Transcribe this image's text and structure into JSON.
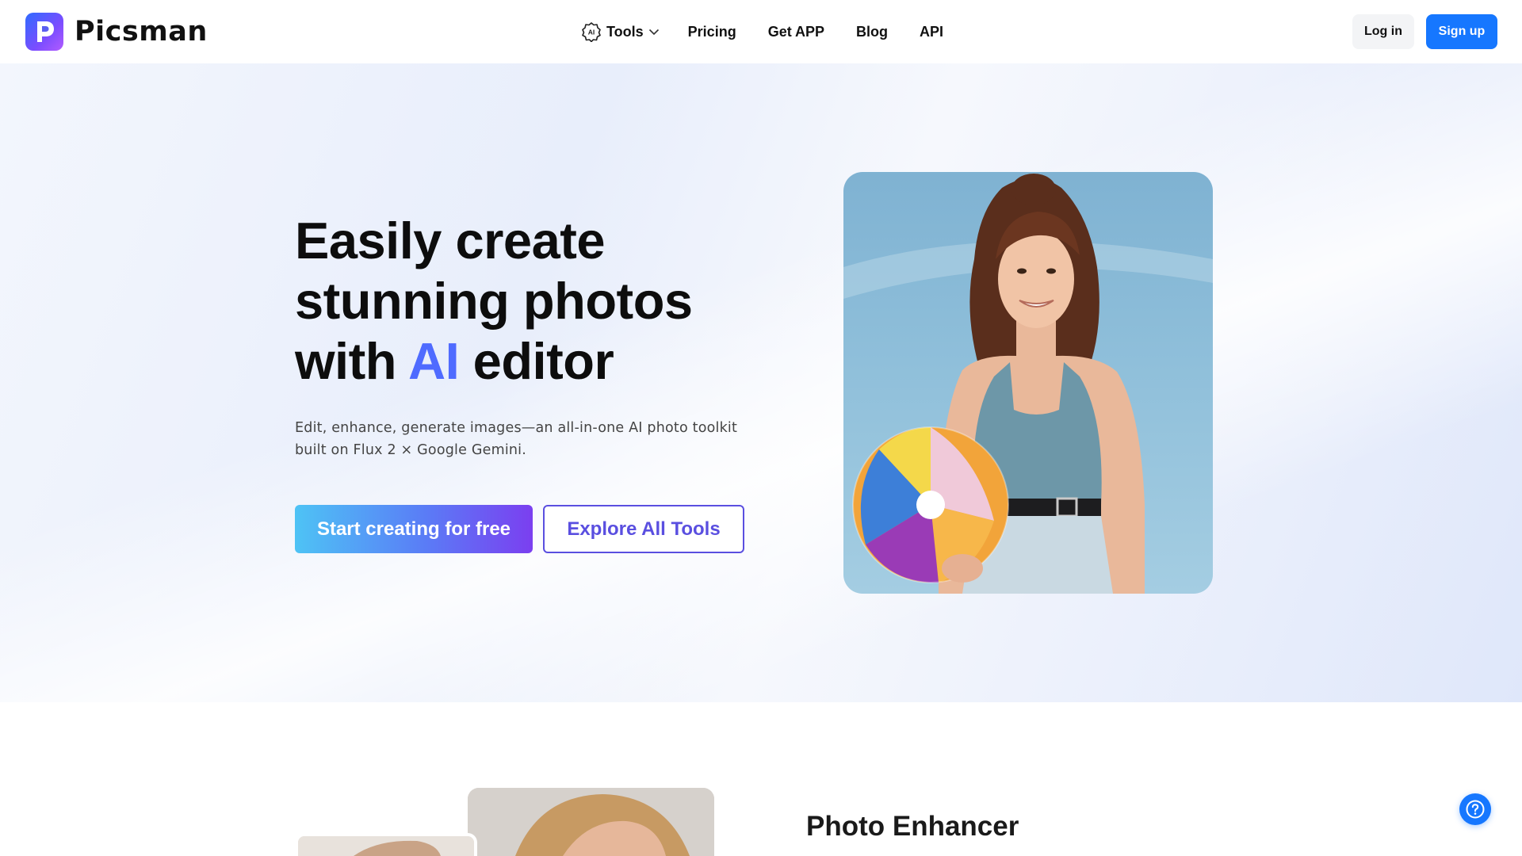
{
  "brand": {
    "name": "Picsman"
  },
  "nav": {
    "tools": "Tools",
    "pricing": "Pricing",
    "get_app": "Get APP",
    "blog": "Blog",
    "api": "API",
    "tools_badge": "AI"
  },
  "auth": {
    "login": "Log in",
    "signup": "Sign up"
  },
  "hero": {
    "title_line1": "Easily create",
    "title_line2": "stunning photos",
    "title_line3_pre": "with ",
    "title_line3_ai": "AI",
    "title_line3_post": " editor",
    "subtitle_line1": "Edit, enhance, generate images—an all-in-one AI photo toolkit",
    "subtitle_line2": "built on Flux 2 × Google Gemini.",
    "cta_primary": "Start creating for free",
    "cta_secondary": "Explore All Tools"
  },
  "feature": {
    "title": "Photo Enhancer"
  },
  "icons": {
    "logo": "picsman-logo-icon",
    "tools": "ai-badge-icon",
    "dropdown": "chevron-down-icon",
    "help": "help-icon"
  },
  "colors": {
    "primary": "#1677ff",
    "accent_purple": "#5a4fe0",
    "ai_gradient_start": "#4a7bff",
    "ai_gradient_end": "#6b4dff"
  }
}
